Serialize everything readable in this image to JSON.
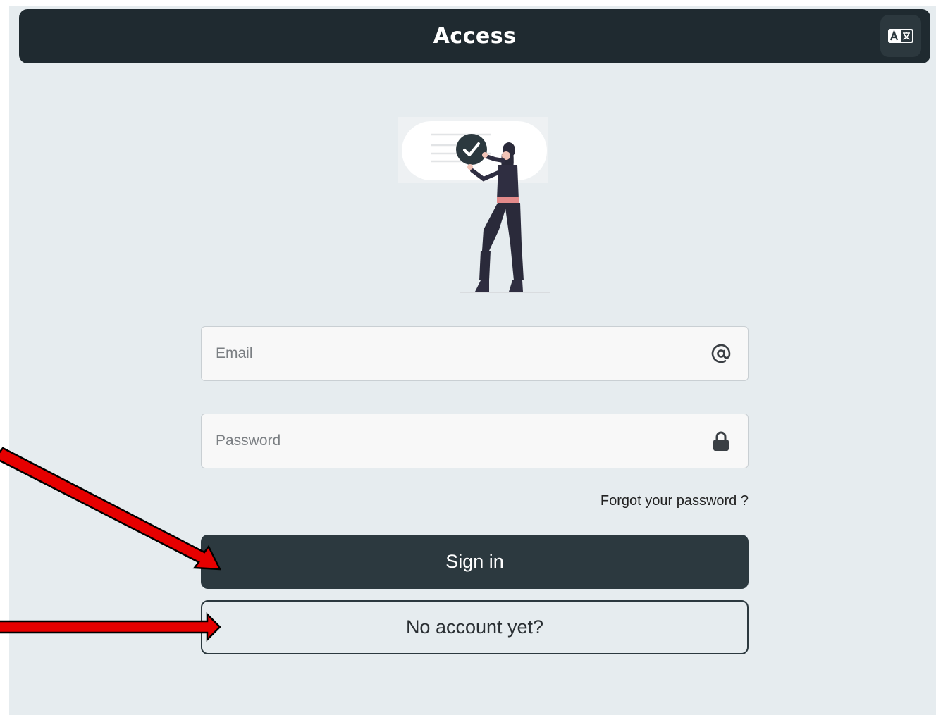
{
  "header": {
    "title": "Access",
    "language_button_icon": "translate-icon"
  },
  "form": {
    "email": {
      "placeholder": "Email",
      "value": "",
      "icon": "at-icon"
    },
    "password": {
      "placeholder": "Password",
      "value": "",
      "icon": "lock-icon"
    },
    "forgot_label": "Forgot your password ?",
    "sign_in_label": "Sign in",
    "no_account_label": "No account yet?"
  },
  "illustration": {
    "icon": "person-checkmark-illustration"
  },
  "annotations": {
    "arrow_color": "#e60000",
    "targets": [
      "sign-in-button",
      "no-account-button"
    ]
  },
  "colors": {
    "header_bg": "#1f2a30",
    "page_bg": "#e6ecef",
    "primary_button": "#2c393f"
  }
}
